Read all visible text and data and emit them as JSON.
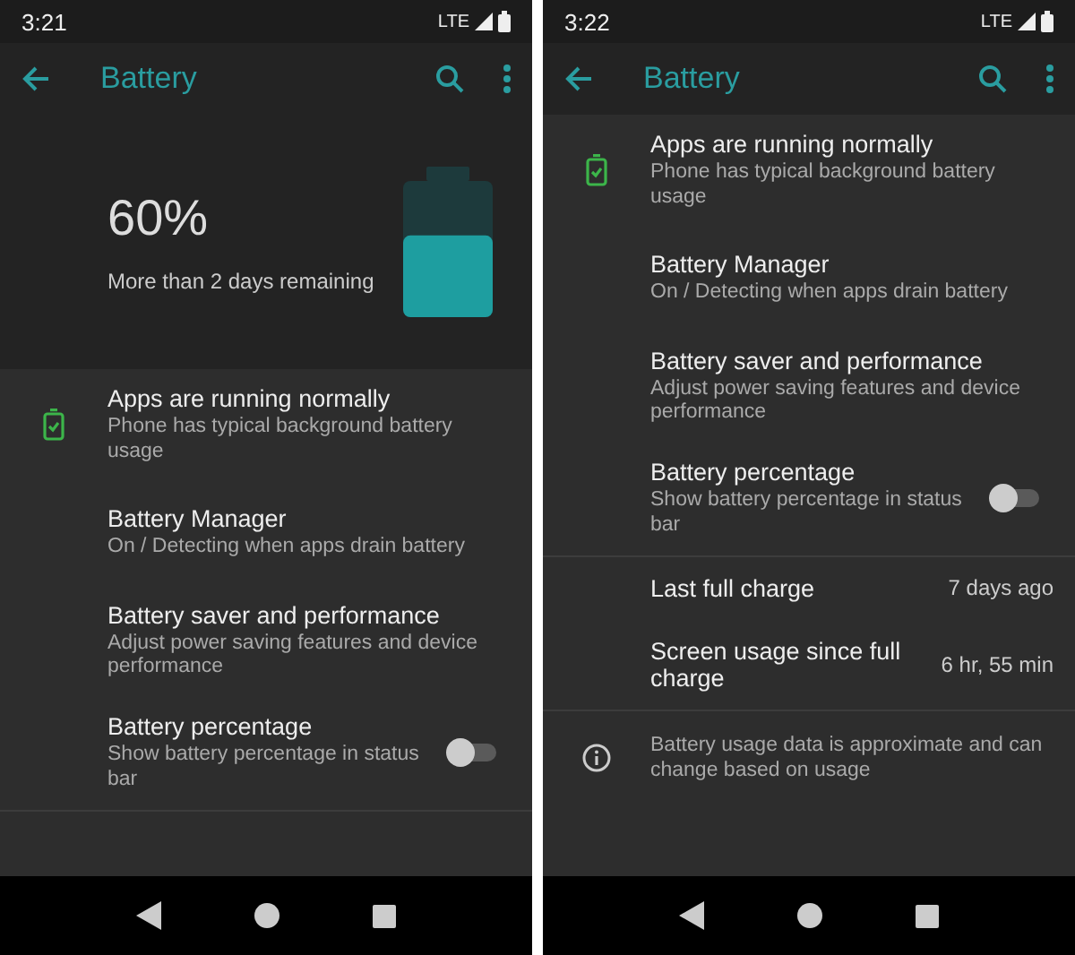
{
  "screens": [
    {
      "time": "3:21",
      "network": "LTE",
      "title": "Battery",
      "sections": [
        {
          "kind": "header",
          "percent": "60%",
          "remaining": "More than 2 days remaining",
          "level": 0.6
        },
        {
          "kind": "settings",
          "items": [
            {
              "kind": "icon",
              "title": "Apps are running normally",
              "summary": "Phone has typical background battery usage"
            },
            {
              "kind": "plain",
              "title": "Battery Manager",
              "summary": "On / Detecting when apps drain battery"
            },
            {
              "kind": "plain",
              "title": "Battery saver and performance",
              "summary": "Adjust power saving features and device performance"
            },
            {
              "kind": "toggle",
              "title": "Battery percentage",
              "summary": "Show battery percentage in status bar",
              "on": false
            }
          ]
        }
      ]
    },
    {
      "time": "3:22",
      "network": "LTE",
      "title": "Battery",
      "sections": [
        {
          "kind": "settings",
          "items": [
            {
              "kind": "icon",
              "title": "Apps are running normally",
              "summary": "Phone has typical background battery usage"
            },
            {
              "kind": "plain",
              "title": "Battery Manager",
              "summary": "On / Detecting when apps drain battery"
            },
            {
              "kind": "plain",
              "title": "Battery saver and performance",
              "summary": "Adjust power saving features and device performance"
            },
            {
              "kind": "toggle",
              "title": "Battery percentage",
              "summary": "Show battery percentage in status bar",
              "on": false
            }
          ]
        },
        {
          "kind": "stats",
          "rows": [
            {
              "label": "Last full charge",
              "value": "7 days ago"
            },
            {
              "label": "Screen usage since full charge",
              "value": "6 hr, 55 min"
            }
          ]
        },
        {
          "kind": "info",
          "text": "Battery usage data is approximate and can change based on usage"
        }
      ]
    }
  ]
}
